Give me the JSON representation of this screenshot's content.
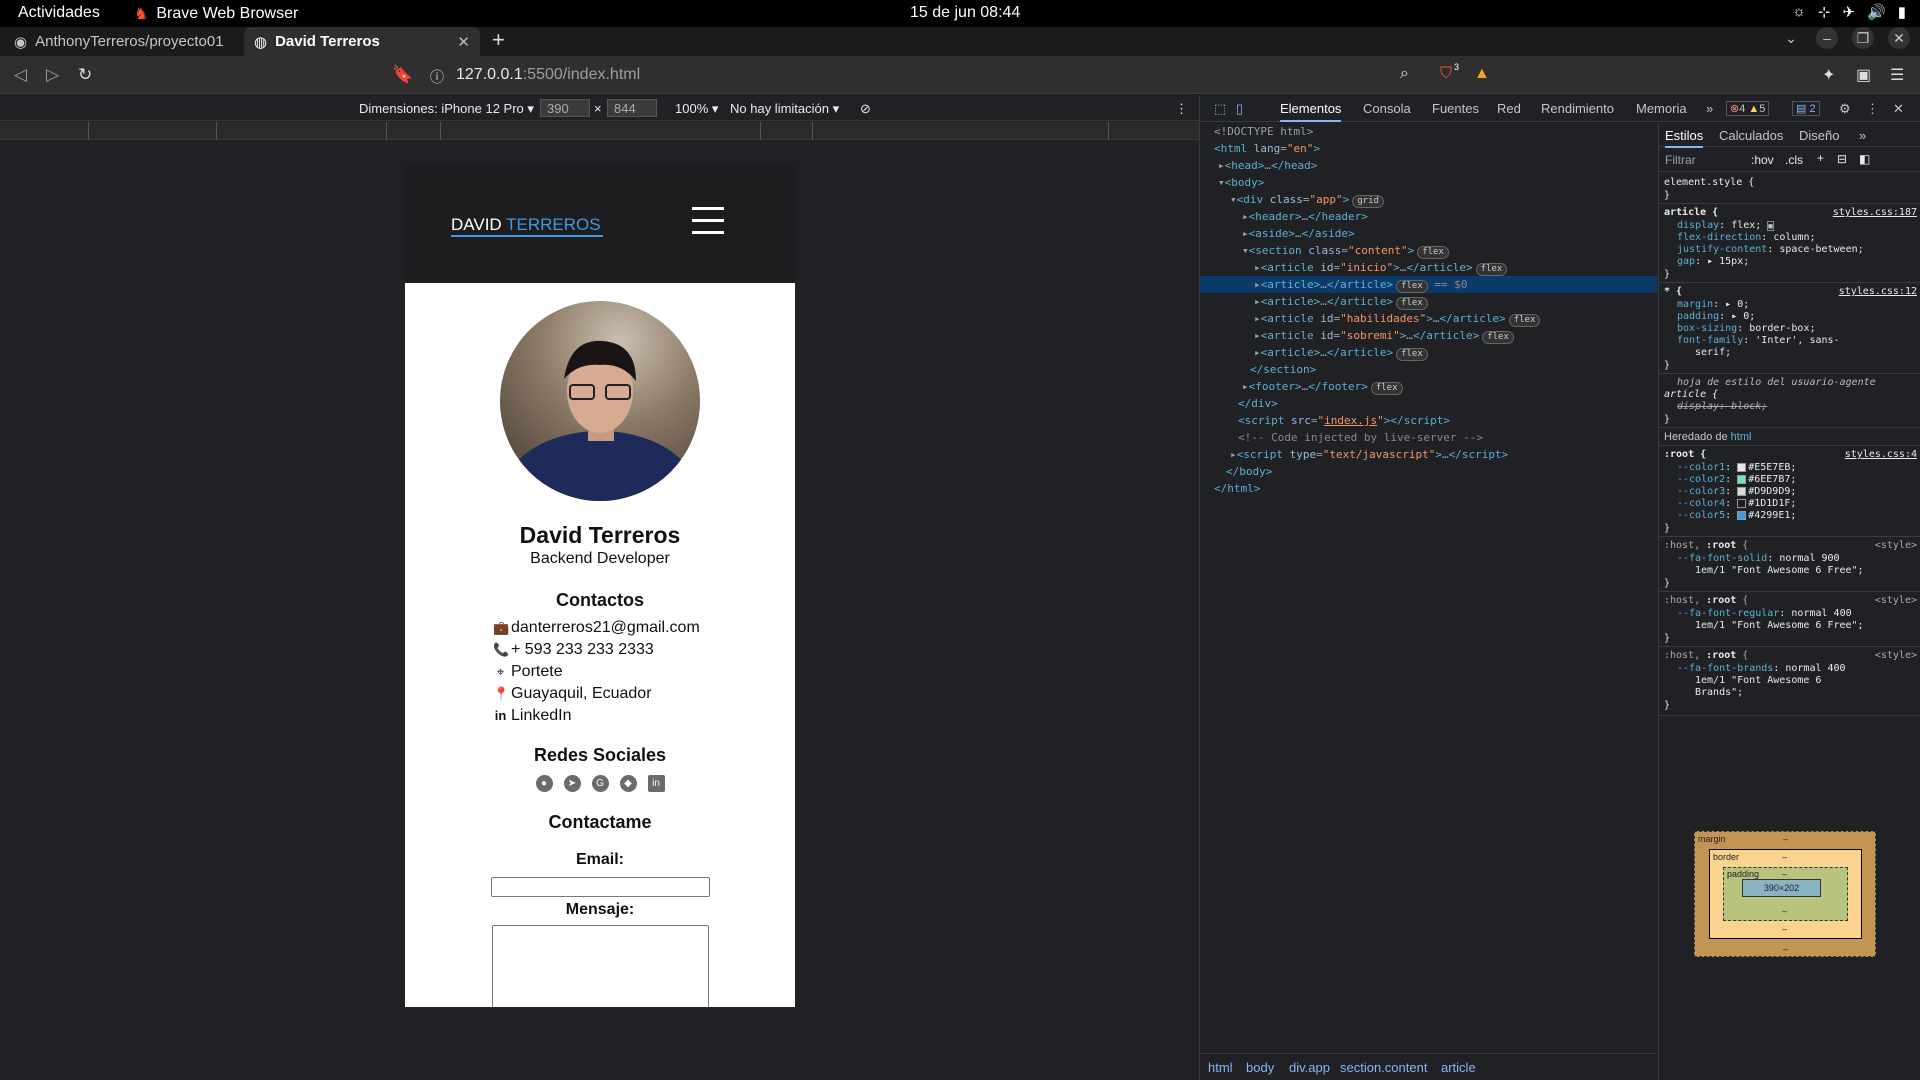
{
  "os": {
    "activities": "Actividades",
    "app_name": "Brave Web Browser",
    "clock": "15 de jun  08:44"
  },
  "browser": {
    "tabs": [
      {
        "title": "AnthonyTerreros/proyecto01"
      },
      {
        "title": "David Terreros"
      }
    ],
    "url_host": "127.0.0.1",
    "url_path": ":5500/index.html",
    "shield_count": "3"
  },
  "device_toolbar": {
    "device": "Dimensiones: iPhone 12 Pro",
    "width": "390",
    "times": "×",
    "height": "844",
    "zoom": "100%",
    "throttle": "No hay limitación"
  },
  "page": {
    "logo_first": "DAVID",
    "logo_last": "TERREROS",
    "name": "David Terreros",
    "role": "Backend Developer",
    "contacts_title": "Contactos",
    "contacts": [
      {
        "icon": "briefcase-icon",
        "glyph": "💼",
        "text": "danterreros21@gmail.com"
      },
      {
        "icon": "phone-icon",
        "glyph": "📞",
        "text": "+ 593 233 233 2333"
      },
      {
        "icon": "crosshair-icon",
        "glyph": "⌖",
        "text": "Portete"
      },
      {
        "icon": "map-pin-icon",
        "glyph": "📍",
        "text": "Guayaquil, Ecuador"
      },
      {
        "icon": "linkedin-icon",
        "glyph": "in",
        "text": "LinkedIn"
      }
    ],
    "social_title": "Redes Sociales",
    "social_icons": [
      "github-icon",
      "telegram-icon",
      "google-icon",
      "gitlab-icon",
      "linkedin-square-icon"
    ],
    "contact_form_title": "Contactame",
    "email_label": "Email:",
    "message_label": "Mensaje:"
  },
  "devtools": {
    "tabs": [
      "Elementos",
      "Consola",
      "Fuentes",
      "Red",
      "Rendimiento",
      "Memoria"
    ],
    "errors": "4",
    "warnings": "5",
    "messages": "2",
    "breadcrumbs": [
      "html",
      "body",
      "div.app",
      "section.content",
      "article"
    ],
    "styles_tabs": [
      "Estilos",
      "Calculados",
      "Diseño"
    ],
    "filter_placeholder": "Filtrar",
    "hov": ":hov",
    "cls": ".cls",
    "box_size": "390×202",
    "box_labels": {
      "margin": "margin",
      "border": "border",
      "padding": "padding",
      "dash": "–"
    }
  },
  "colors": {
    "color1": "#E5E7EB",
    "color2": "#6EE7B7",
    "color3": "#D9D9D9",
    "color4": "#1D1D1F",
    "color5": "#4299E1"
  }
}
